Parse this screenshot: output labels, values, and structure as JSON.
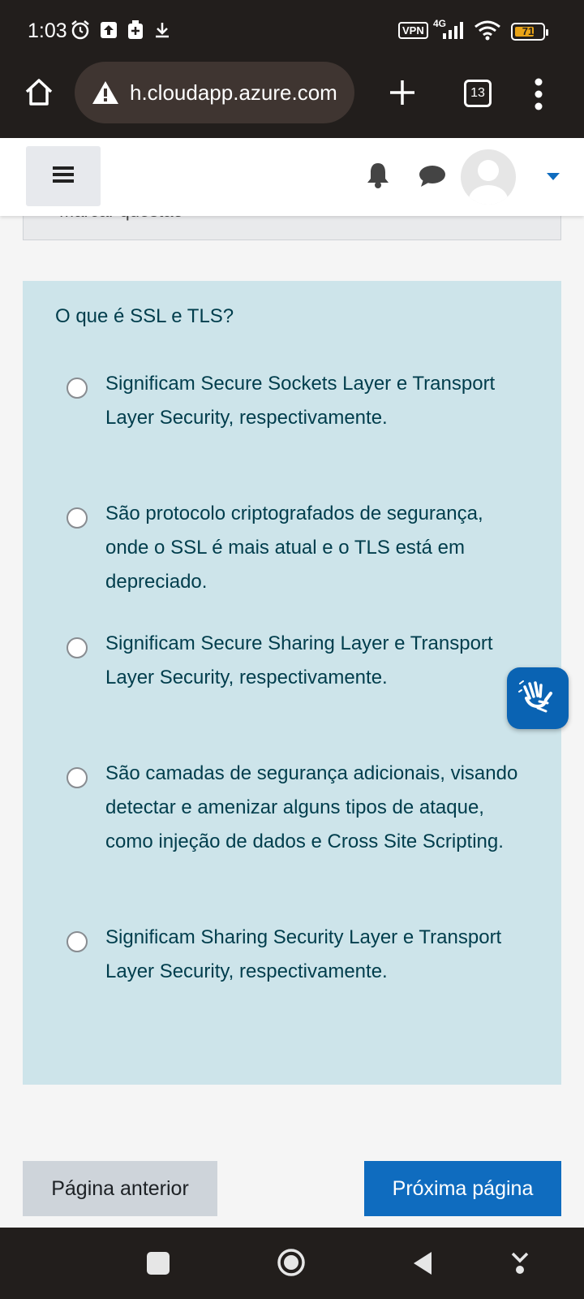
{
  "status_bar": {
    "time": "1:03",
    "vpn": "VPN",
    "network": "4G",
    "battery_level": "71",
    "battery_fraction": 0.71,
    "icons": [
      "alarm-icon",
      "upload-icon",
      "sim-icon",
      "download-icon",
      "signal-icon",
      "wifi-icon",
      "battery-icon"
    ]
  },
  "browser": {
    "url": "h.cloudapp.azure.com",
    "tab_count": "13",
    "icons": [
      "home-icon",
      "warning-icon",
      "plus-icon",
      "tabs-icon",
      "more-vert-icon"
    ]
  },
  "header": {
    "icons": [
      "hamburger-icon",
      "bell-icon",
      "chat-icon",
      "avatar-icon",
      "caret-down-icon"
    ]
  },
  "flag": {
    "label": "Marcar questão"
  },
  "question": {
    "text": "O que é SSL e TLS?",
    "options": [
      "Significam Secure Sockets Layer e Transport Layer Security, respectivamente.",
      "São protocolo criptografados de segurança, onde o SSL é mais atual e o TLS está em depreciado.",
      "Significam Secure Sharing Layer e Transport Layer Security, respectivamente.",
      "São camadas de segurança adicionais, visando detectar e amenizar alguns tipos de ataque, como injeção de dados e Cross Site Scripting.",
      "Significam Sharing Security Layer e Transport Layer Security, respectivamente."
    ]
  },
  "navigation": {
    "prev_label": "Página anterior",
    "next_label": "Próxima página"
  },
  "colors": {
    "card_bg": "#cde4ea",
    "text": "#003d4c",
    "primary": "#0f6cbf",
    "secondary": "#ced4da",
    "system_bar": "#221e1c"
  }
}
